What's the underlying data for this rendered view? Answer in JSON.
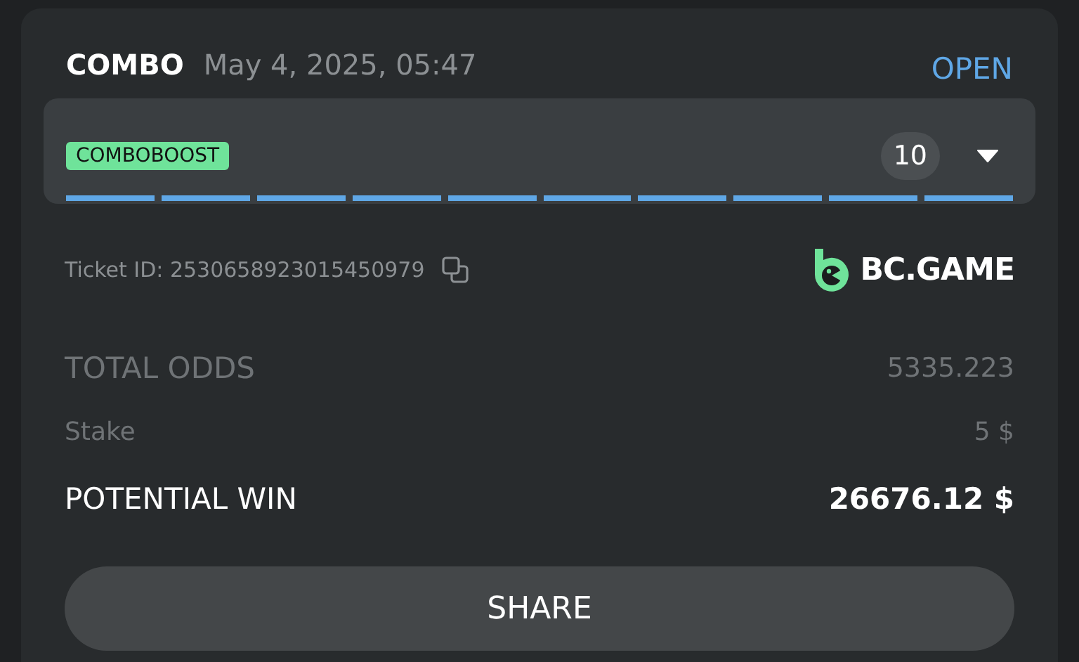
{
  "header": {
    "type": "COMBO",
    "date": "May 4, 2025, 05:47",
    "status": "OPEN"
  },
  "boost": {
    "badge": "COMBOBOOST",
    "count": "10",
    "expanded": false,
    "segments": [
      {
        "filled": true
      },
      {
        "filled": true
      },
      {
        "filled": true
      },
      {
        "filled": true
      },
      {
        "filled": true
      },
      {
        "filled": true
      },
      {
        "filled": true
      },
      {
        "filled": true
      },
      {
        "filled": true
      },
      {
        "filled": true
      }
    ]
  },
  "ticket": {
    "label": "Ticket ID: 2530658923015450979",
    "brand": "BC.GAME"
  },
  "summary": [
    {
      "kind": "muted",
      "label": "TOTAL ODDS",
      "value": "5335.223"
    },
    {
      "kind": "small",
      "label": "Stake",
      "value": "5 $"
    },
    {
      "kind": "strong",
      "label": "POTENTIAL WIN",
      "value": "26676.12 $"
    }
  ],
  "button": "SHARE"
}
